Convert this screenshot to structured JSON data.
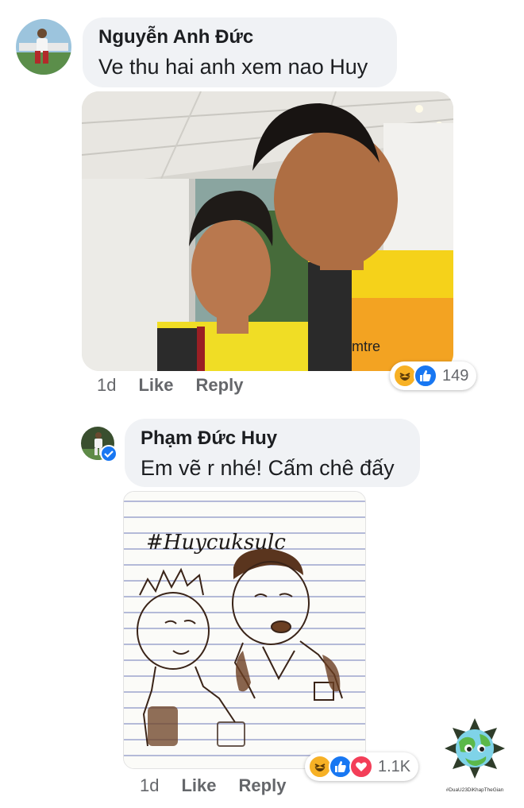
{
  "comments": [
    {
      "author": "Nguyễn Anh Đức",
      "text": "Ve thu hai anh xem nao Huy",
      "time": "1d",
      "like": "Like",
      "reply": "Reply",
      "reaction_count": "149",
      "reaction_icons": [
        "haha-icon",
        "like-icon"
      ]
    },
    {
      "author": "Phạm Đức Huy",
      "text": "Em vẽ r nhé! Cấm chê đấy",
      "time": "1d",
      "like": "Like",
      "reply": "Reply",
      "reaction_count": "1.1K",
      "reaction_icons": [
        "haha-icon",
        "like-icon",
        "love-icon"
      ],
      "verified": true
    }
  ],
  "drawing": {
    "hashtag": "#Huycuksulc"
  },
  "watermark": {
    "caption": "#DuaU23DiKhapTheGian"
  },
  "colors": {
    "bubble": "#f0f2f5",
    "like_blue": "#1877f2",
    "love_red": "#f33e58",
    "haha_yellow": "#f7b125"
  }
}
